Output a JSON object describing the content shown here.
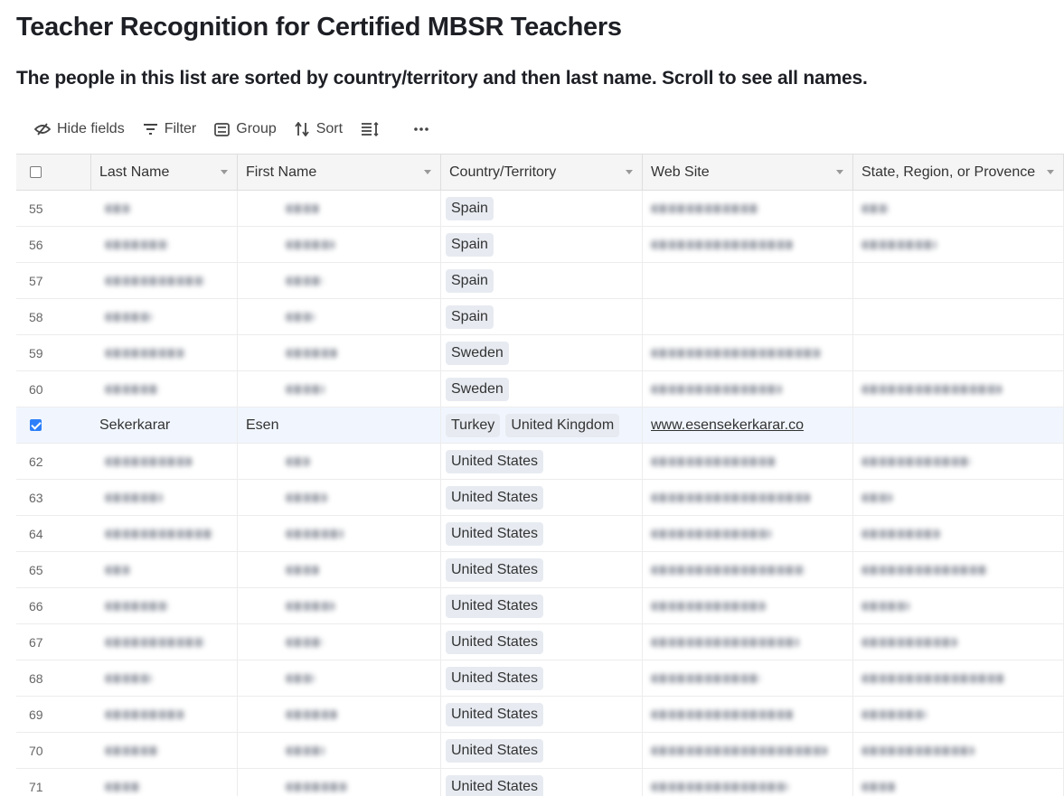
{
  "title": "Teacher Recognition for Certified MBSR Teachers",
  "subtitle": "The people in this list are sorted by country/territory and then last name. Scroll to see all names.",
  "toolbar": {
    "hide_fields": "Hide fields",
    "filter": "Filter",
    "group": "Group",
    "sort": "Sort"
  },
  "icons": [
    "hide-fields-icon",
    "filter-icon",
    "group-icon",
    "sort-icon",
    "row-height-icon",
    "more-icon"
  ],
  "columns": {
    "last_name": "Last Name",
    "first_name": "First Name",
    "country": "Country/Territory",
    "website": "Web Site",
    "state": "State, Region, or Provence"
  },
  "selected_row": {
    "last_name": "Sekerkarar",
    "first_name": "Esen",
    "countries": [
      "Turkey",
      "United Kingdom"
    ],
    "website": "www.esensekerkarar.co"
  },
  "rows": [
    {
      "num": "55",
      "country": "Spain"
    },
    {
      "num": "56",
      "country": "Spain"
    },
    {
      "num": "57",
      "country": "Spain"
    },
    {
      "num": "58",
      "country": "Spain"
    },
    {
      "num": "59",
      "country": "Sweden"
    },
    {
      "num": "60",
      "country": "Sweden"
    },
    {
      "num": "",
      "country": ""
    },
    {
      "num": "62",
      "country": "United States"
    },
    {
      "num": "63",
      "country": "United States"
    },
    {
      "num": "64",
      "country": "United States"
    },
    {
      "num": "65",
      "country": "United States"
    },
    {
      "num": "66",
      "country": "United States"
    },
    {
      "num": "67",
      "country": "United States"
    },
    {
      "num": "68",
      "country": "United States"
    },
    {
      "num": "69",
      "country": "United States"
    },
    {
      "num": "70",
      "country": "United States"
    },
    {
      "num": "71",
      "country": "United States"
    }
  ]
}
